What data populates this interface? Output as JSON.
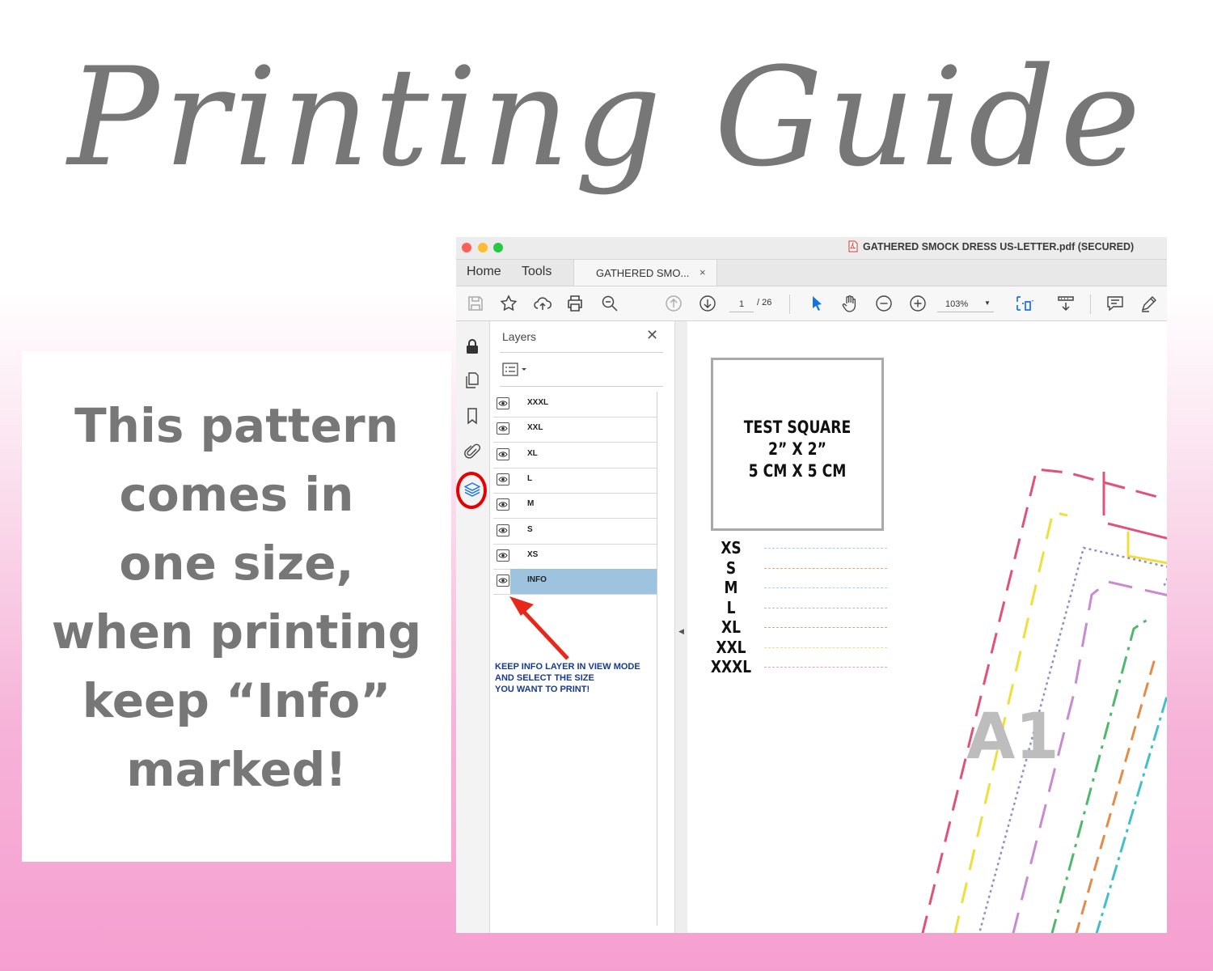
{
  "headline": "Printing Guide",
  "info_card": {
    "lines": [
      "This pattern",
      "comes in",
      "one size,",
      "when printing",
      "keep “Info”",
      "marked!"
    ]
  },
  "window": {
    "title": "GATHERED SMOCK DRESS US-LETTER.pdf (SECURED)",
    "traffic_colors": [
      "#fe5f57",
      "#febc2e",
      "#28c840"
    ],
    "tabs": {
      "home": "Home",
      "tools": "Tools",
      "doc": "GATHERED SMO...",
      "close": "×"
    },
    "toolbar": {
      "page_current": "1",
      "page_total": "/ 26",
      "zoom": "103%",
      "icons": [
        "save-icon",
        "star-icon",
        "upload-icon",
        "print-icon",
        "find-icon",
        "page-up-icon",
        "page-down-icon",
        "select-arrow-icon",
        "hand-icon",
        "zoom-out-icon",
        "zoom-in-icon",
        "fit-page-icon",
        "scroll-mode-icon",
        "comment-icon",
        "pen-icon"
      ],
      "accent": "#1473e6"
    },
    "rail_icons": [
      "lock-icon",
      "pages-icon",
      "bookmark-icon",
      "attachment-icon",
      "layers-icon"
    ],
    "layers_panel": {
      "title": "Layers",
      "close": "✕",
      "layers": [
        {
          "name": "XXXL",
          "selected": false
        },
        {
          "name": "XXL",
          "selected": false
        },
        {
          "name": "XL",
          "selected": false
        },
        {
          "name": "L",
          "selected": false
        },
        {
          "name": "M",
          "selected": false
        },
        {
          "name": "S",
          "selected": false
        },
        {
          "name": "XS",
          "selected": false
        },
        {
          "name": "INFO",
          "selected": true
        }
      ],
      "note": [
        "KEEP INFO LAYER IN VIEW MODE",
        "AND SELECT THE SIZE",
        "YOU WANT TO PRINT!"
      ]
    },
    "document": {
      "test_square": [
        "TEST SQUARE",
        "2” X 2”",
        "5 CM X 5 CM"
      ],
      "size_legend": [
        {
          "label": "XS",
          "color": "#9fd8c8"
        },
        {
          "label": "S",
          "color": "#e0a87a"
        },
        {
          "label": "M",
          "color": "#a6d3e0"
        },
        {
          "label": "L",
          "color": "#bbbbbb"
        },
        {
          "label": "XL",
          "color": "#b9b28a"
        },
        {
          "label": "XXL",
          "color": "#f1e07a"
        },
        {
          "label": "XXXL",
          "color": "#e6a3bd"
        }
      ],
      "piece_label": "A1"
    }
  }
}
